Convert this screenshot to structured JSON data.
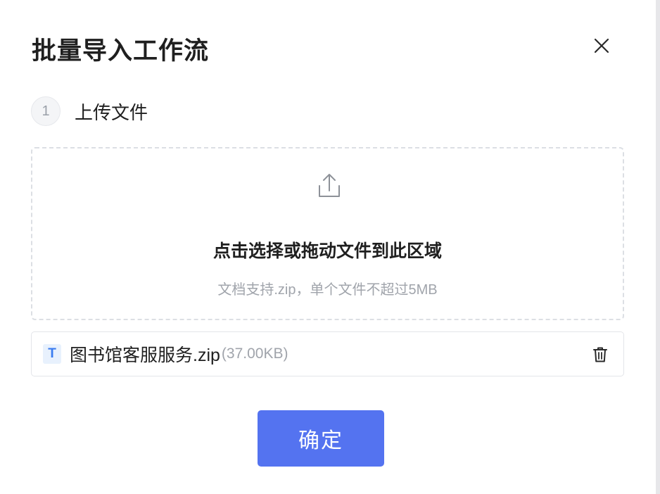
{
  "dialog": {
    "title": "批量导入工作流",
    "close_icon": "close-icon"
  },
  "step": {
    "number": "1",
    "label": "上传文件"
  },
  "dropzone": {
    "icon": "upload-icon",
    "title": "点击选择或拖动文件到此区域",
    "hint": "文档支持.zip，单个文件不超过5MB"
  },
  "file": {
    "type_badge": "T",
    "name": "图书馆客服服务.zip",
    "size": "(37.00KB)",
    "delete_icon": "trash-icon"
  },
  "actions": {
    "confirm_label": "确定"
  },
  "colors": {
    "primary": "#5473f0",
    "file_badge": "#3a7cf0",
    "muted_text": "#a0a4ab"
  }
}
